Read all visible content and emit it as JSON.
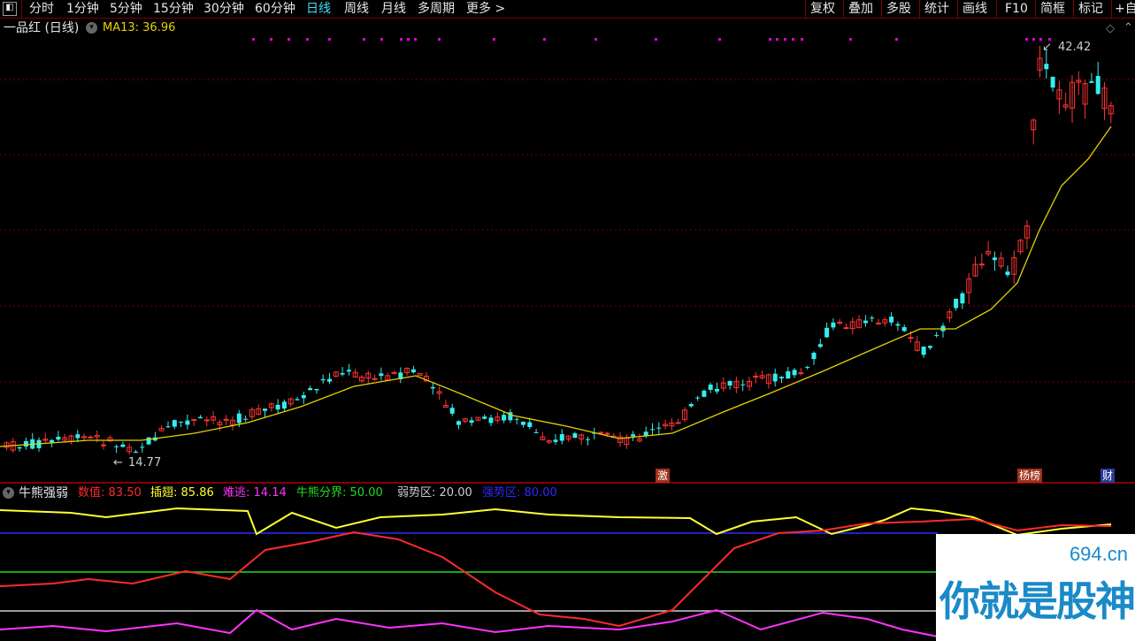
{
  "toolbar": {
    "left_icon": "window-icon",
    "tabs": [
      "分时",
      "1分钟",
      "5分钟",
      "15分钟",
      "30分钟",
      "60分钟",
      "日线",
      "周线",
      "月线",
      "多周期",
      "更多 >"
    ],
    "active_tab": "日线",
    "right_buttons": [
      "复权",
      "叠加",
      "多股",
      "统计",
      "画线",
      "F10",
      "简框",
      "标记",
      "+自"
    ]
  },
  "main": {
    "stock_title": "一品红 (日线)",
    "ma_label": "MA13: 36.96",
    "high_marker": "42.42",
    "low_marker": "14.77",
    "tags": [
      "激",
      "杨榜",
      "财"
    ]
  },
  "indicator": {
    "name": "牛熊强弱",
    "items": [
      {
        "label": "数值:",
        "value": "83.50",
        "color": "#ff2a2a"
      },
      {
        "label": "插翅:",
        "value": "85.86",
        "color": "#ffff33"
      },
      {
        "label": "难逃:",
        "value": "14.14",
        "color": "#ff33ff"
      },
      {
        "label": "牛熊分界:",
        "value": "50.00",
        "color": "#22dd22"
      },
      {
        "label": "弱势区:",
        "value": "20.00",
        "color": "#cccccc"
      },
      {
        "label": "强势区:",
        "value": "80.00",
        "color": "#2a2aff"
      }
    ]
  },
  "watermark": {
    "site": "694.cn",
    "text": "你就是股神"
  },
  "colors": {
    "up": "#ff3333",
    "down": "#33eeee",
    "ma": "#e6d200",
    "grid": "#7a0000",
    "dots": "#e000e0"
  }
}
